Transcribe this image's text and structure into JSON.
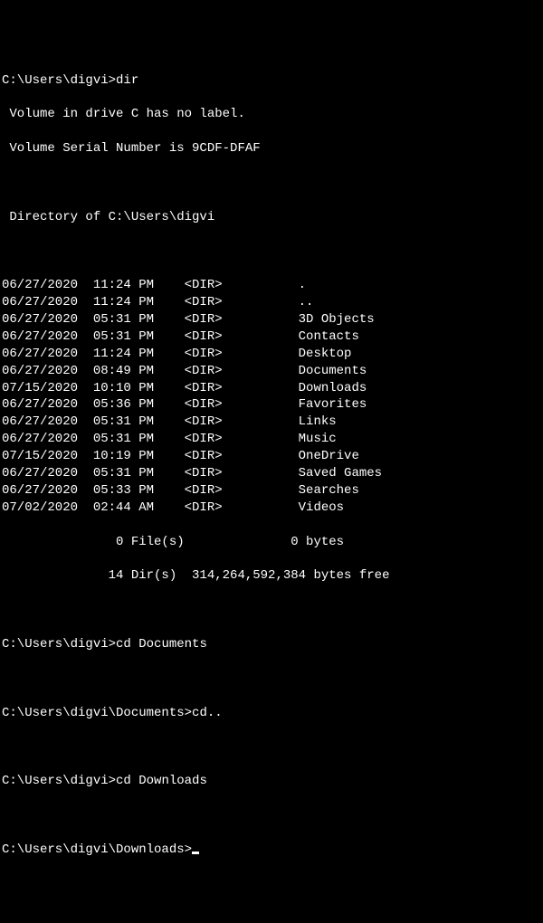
{
  "prompt1": "C:\\Users\\digvi>",
  "cmd1": "dir",
  "vol1": " Volume in drive C has no label.",
  "vol2": " Volume Serial Number is 9CDF-DFAF",
  "dirOf": " Directory of C:\\Users\\digvi",
  "rows": [
    {
      "date": "06/27/2020",
      "time": "11:24 PM",
      "type": "<DIR>",
      "name": "."
    },
    {
      "date": "06/27/2020",
      "time": "11:24 PM",
      "type": "<DIR>",
      "name": ".."
    },
    {
      "date": "06/27/2020",
      "time": "05:31 PM",
      "type": "<DIR>",
      "name": "3D Objects"
    },
    {
      "date": "06/27/2020",
      "time": "05:31 PM",
      "type": "<DIR>",
      "name": "Contacts"
    },
    {
      "date": "06/27/2020",
      "time": "11:24 PM",
      "type": "<DIR>",
      "name": "Desktop"
    },
    {
      "date": "06/27/2020",
      "time": "08:49 PM",
      "type": "<DIR>",
      "name": "Documents"
    },
    {
      "date": "07/15/2020",
      "time": "10:10 PM",
      "type": "<DIR>",
      "name": "Downloads"
    },
    {
      "date": "06/27/2020",
      "time": "05:36 PM",
      "type": "<DIR>",
      "name": "Favorites"
    },
    {
      "date": "06/27/2020",
      "time": "05:31 PM",
      "type": "<DIR>",
      "name": "Links"
    },
    {
      "date": "06/27/2020",
      "time": "05:31 PM",
      "type": "<DIR>",
      "name": "Music"
    },
    {
      "date": "07/15/2020",
      "time": "10:19 PM",
      "type": "<DIR>",
      "name": "OneDrive"
    },
    {
      "date": "06/27/2020",
      "time": "05:31 PM",
      "type": "<DIR>",
      "name": "Saved Games"
    },
    {
      "date": "06/27/2020",
      "time": "05:33 PM",
      "type": "<DIR>",
      "name": "Searches"
    },
    {
      "date": "07/02/2020",
      "time": "02:44 AM",
      "type": "<DIR>",
      "name": "Videos"
    }
  ],
  "summary1": "               0 File(s)              0 bytes",
  "summary2": "              14 Dir(s)  314,264,592,384 bytes free",
  "prompt2": "C:\\Users\\digvi>",
  "cmd2": "cd Documents",
  "prompt3": "C:\\Users\\digvi\\Documents>",
  "cmd3": "cd..",
  "prompt4": "C:\\Users\\digvi>",
  "cmd4": "cd Downloads",
  "prompt5": "C:\\Users\\digvi\\Downloads>",
  "cmd5": ""
}
